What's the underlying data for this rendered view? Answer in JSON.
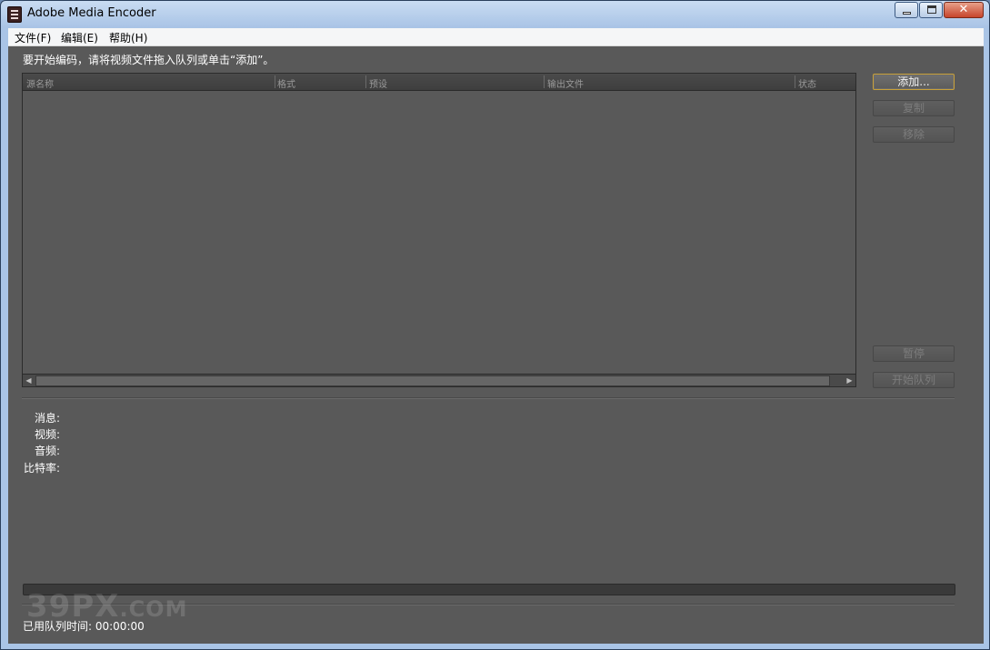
{
  "window": {
    "title": "Adobe Media Encoder"
  },
  "menu": [
    "文件(F)",
    "编辑(E)",
    "帮助(H)"
  ],
  "instruction": "要开始编码，请将视频文件拖入队列或单击“添加”。",
  "queue": {
    "columns": [
      "源名称",
      "格式",
      "预设",
      "输出文件",
      "状态"
    ]
  },
  "buttons": {
    "add": "添加...",
    "duplicate": "复制",
    "remove": "移除",
    "pause": "暂停",
    "start_queue": "开始队列"
  },
  "info": {
    "message": "消息:",
    "video": "视频:",
    "audio": "音频:",
    "bitrate": "比特率:"
  },
  "elapsed": "已用队列时间: 00:00:00",
  "watermark": {
    "main": "39PX",
    "suffix": ".COM"
  },
  "colors": {
    "panel": "#595959",
    "accent_border": "#c9a13a",
    "titlebar": "#a9c4e6"
  }
}
